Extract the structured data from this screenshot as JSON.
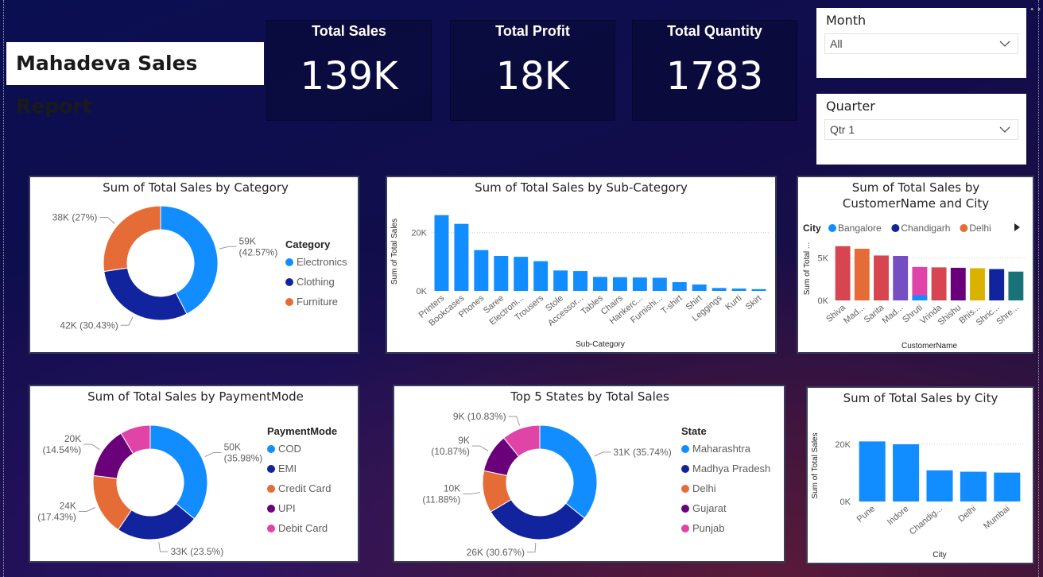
{
  "report": {
    "title": "Mahadeva Sales Report"
  },
  "kpis": [
    {
      "label": "Total Sales",
      "value": "139K"
    },
    {
      "label": "Total Profit",
      "value": "18K"
    },
    {
      "label": "Total Quantity",
      "value": "1783"
    }
  ],
  "filters": {
    "month": {
      "label": "Month",
      "value": "All"
    },
    "quarter": {
      "label": "Quarter",
      "value": "Qtr 1"
    }
  },
  "chart_data": [
    {
      "id": "category",
      "type": "pie",
      "title": "Sum of Total Sales by Category",
      "legend_title": "Category",
      "legend_placement": "right",
      "slices": [
        {
          "name": "Electronics",
          "value": 59,
          "label_lines": [
            "59K",
            "(42.57%)"
          ],
          "color": "#118DFF"
        },
        {
          "name": "Clothing",
          "value": 42,
          "label_lines": [
            "42K (30.43%)"
          ],
          "color": "#12239E"
        },
        {
          "name": "Furniture",
          "value": 38,
          "label_lines": [
            "38K (27%)"
          ],
          "color": "#E66C37"
        }
      ]
    },
    {
      "id": "subcategory",
      "type": "bar",
      "title": "Sum of Total Sales by Sub-Category",
      "xlabel": "Sub-Category",
      "ylabel": "Sum of Total Sales",
      "ylim": [
        0,
        27000
      ],
      "yticks": [
        {
          "value": 0,
          "label": "0K"
        },
        {
          "value": 20000,
          "label": "20K"
        }
      ],
      "categories": [
        "Printers",
        "Bookcases",
        "Phones",
        "Saree",
        "Electroni...",
        "Trousers",
        "Stole",
        "Accessor...",
        "Tables",
        "Chairs",
        "Hankerc...",
        "Furnishi...",
        "T-shirt",
        "Shirt",
        "Leggings",
        "Kurti",
        "Skirt"
      ],
      "values": [
        26000,
        23000,
        14000,
        12000,
        11700,
        10200,
        7000,
        6800,
        4800,
        4700,
        4600,
        4500,
        3000,
        2200,
        1000,
        800,
        600
      ],
      "color": "#118DFF"
    },
    {
      "id": "customer",
      "type": "bar",
      "title_lines": [
        "Sum of Total Sales by",
        "CustomerName and City"
      ],
      "xlabel": "CustomerName",
      "ylabel": "Sum of Total ...",
      "legend_title": "City",
      "legend": [
        {
          "name": "Bangalore",
          "color": "#118DFF"
        },
        {
          "name": "Chandigarh",
          "color": "#12239E"
        },
        {
          "name": "Delhi",
          "color": "#E66C37"
        }
      ],
      "ylim": [
        0,
        7500
      ],
      "yticks": [
        {
          "value": 0,
          "label": "0K"
        },
        {
          "value": 5000,
          "label": "5K"
        }
      ],
      "categories": [
        "Shiva",
        "Mad...",
        "Sarita",
        "Mad...",
        "Shruti",
        "Vrinda",
        "Shishu",
        "Bhis...",
        "Shric...",
        "Shre..."
      ],
      "values": [
        6400,
        6100,
        5300,
        5250,
        3950,
        3900,
        3850,
        3800,
        3700,
        3400
      ],
      "colors": [
        "#D64550",
        "#E66C37",
        "#D64550",
        "#744EC2",
        "#E044A7",
        "#D64550",
        "#6B007B",
        "#D9B300",
        "#12239E",
        "#197278"
      ],
      "stack_bottom": {
        "index": 4,
        "value": 600,
        "color": "#118DFF"
      }
    },
    {
      "id": "payment",
      "type": "pie",
      "title": "Sum of Total Sales by PaymentMode",
      "legend_title": "PaymentMode",
      "legend_placement": "right",
      "slices": [
        {
          "name": "COD",
          "value": 35.98,
          "label_lines": [
            "50K",
            "(35.98%)"
          ],
          "color": "#118DFF"
        },
        {
          "name": "EMI",
          "value": 23.5,
          "label_lines": [
            "33K (23.5%)"
          ],
          "color": "#12239E"
        },
        {
          "name": "Credit Card",
          "value": 17.43,
          "label_lines": [
            "24K",
            "(17.43%)"
          ],
          "color": "#E66C37"
        },
        {
          "name": "UPI",
          "value": 14.54,
          "label_lines": [
            "20K",
            "(14.54%)"
          ],
          "color": "#6B007B"
        },
        {
          "name": "Debit Card",
          "value": 8.55,
          "label_lines": [],
          "color": "#E044A7"
        }
      ]
    },
    {
      "id": "states",
      "type": "pie",
      "title": "Top 5 States by Total Sales",
      "legend_title": "State",
      "legend_placement": "right",
      "slices": [
        {
          "name": "Maharashtra",
          "value": 35.74,
          "label_lines": [
            "31K (35.74%)"
          ],
          "color": "#118DFF"
        },
        {
          "name": "Madhya Pradesh",
          "value": 30.67,
          "label_lines": [
            "26K (30.67%)"
          ],
          "color": "#12239E"
        },
        {
          "name": "Delhi",
          "value": 11.88,
          "label_lines": [
            "10K",
            "(11.88%)"
          ],
          "color": "#E66C37"
        },
        {
          "name": "Gujarat",
          "value": 10.87,
          "label_lines": [
            "9K",
            "(10.87%)"
          ],
          "color": "#6B007B"
        },
        {
          "name": "Punjab",
          "value": 10.83,
          "label_lines": [
            "9K (10.83%)"
          ],
          "color": "#E044A7"
        }
      ]
    },
    {
      "id": "city",
      "type": "bar",
      "title": "Sum of Total Sales by City",
      "xlabel": "City",
      "ylabel": "Sum of Total Sales",
      "ylim": [
        0,
        25000
      ],
      "yticks": [
        {
          "value": 0,
          "label": "0K"
        },
        {
          "value": 20000,
          "label": "20K"
        }
      ],
      "categories": [
        "Pune",
        "Indore",
        "Chandig...",
        "Delhi",
        "Mumbai"
      ],
      "values": [
        21000,
        20000,
        10900,
        10400,
        10100
      ],
      "color": "#118DFF"
    }
  ]
}
